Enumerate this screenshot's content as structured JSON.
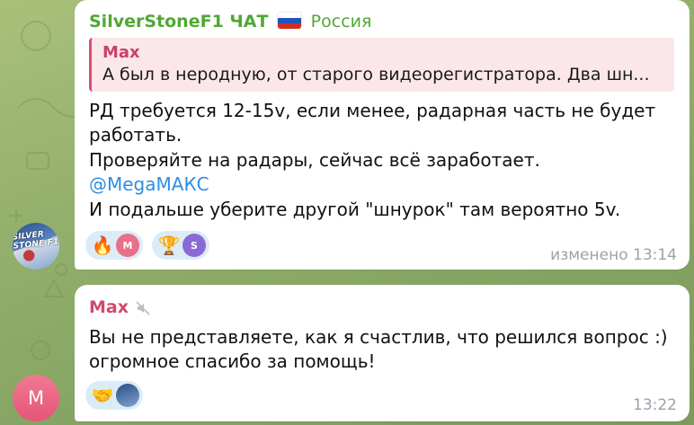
{
  "message1": {
    "sender": "SilverStoneF1 ЧАТ",
    "sender_region": "Россия",
    "reply": {
      "name": "Max",
      "text": "А был в неродную, от старого видеорегистратора. Два шн..."
    },
    "lines": [
      "РД требуется 12-15v, если менее, радарная часть не будет",
      "работать.",
      "Проверяйте на радары, сейчас всё заработает."
    ],
    "mention": "@MegaМАКС",
    "last_line": "И подальше уберите другой \"шнурок\" там вероятно 5v.",
    "reactions": [
      {
        "emoji": "🔥",
        "user_initial": "M",
        "color": "#e8708a"
      },
      {
        "emoji": "🏆",
        "user_initial": "S",
        "color": "#8a6ad6"
      }
    ],
    "time": "изменено 13:14",
    "avatar_text": "SILVER STONE F1"
  },
  "message2": {
    "sender": "Max",
    "lines": [
      "Вы не представляете, как я счастлив, что решился вопрос :)",
      "огромное спасибо за помощь!"
    ],
    "reactions": [
      {
        "emoji": "🤝",
        "user_initial": ""
      }
    ],
    "time": "13:22",
    "avatar_initial": "M"
  },
  "colors": {
    "channel_name": "#4fa835",
    "user_name": "#d14a6f",
    "mention": "#2f8de4",
    "reaction_bg": "#dcecf7",
    "reply_bar": "#d64f74"
  },
  "icons": [
    "muted-speaker-icon",
    "russia-flag-icon"
  ]
}
